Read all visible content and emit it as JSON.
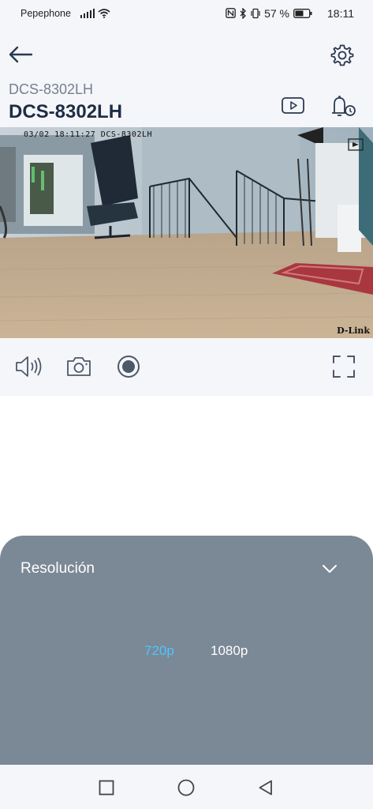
{
  "status_bar": {
    "carrier": "Pepephone",
    "battery": "57 %",
    "time": "18:11"
  },
  "header": {
    "back_icon": "arrow-left-icon",
    "settings_icon": "gear-icon",
    "subtitle": "DCS-8302LH",
    "title": "DCS-8302LH",
    "playback_icon": "video-playback-icon",
    "event_icon": "alarm-bell-icon"
  },
  "video": {
    "timestamp": "03/02 18:11:27 DCS-8302LH",
    "brand": "D-Link"
  },
  "controls": {
    "items": [
      "speaker-icon",
      "camera-snapshot-icon",
      "record-icon",
      "fullscreen-icon"
    ]
  },
  "sheet": {
    "title": "Resolución",
    "options": [
      "720p",
      "1080p"
    ],
    "selected": "720p",
    "selected_color": "#4bc8ff"
  },
  "nav": {
    "items": [
      "recent-apps-icon",
      "home-icon",
      "back-triangle-icon"
    ]
  }
}
